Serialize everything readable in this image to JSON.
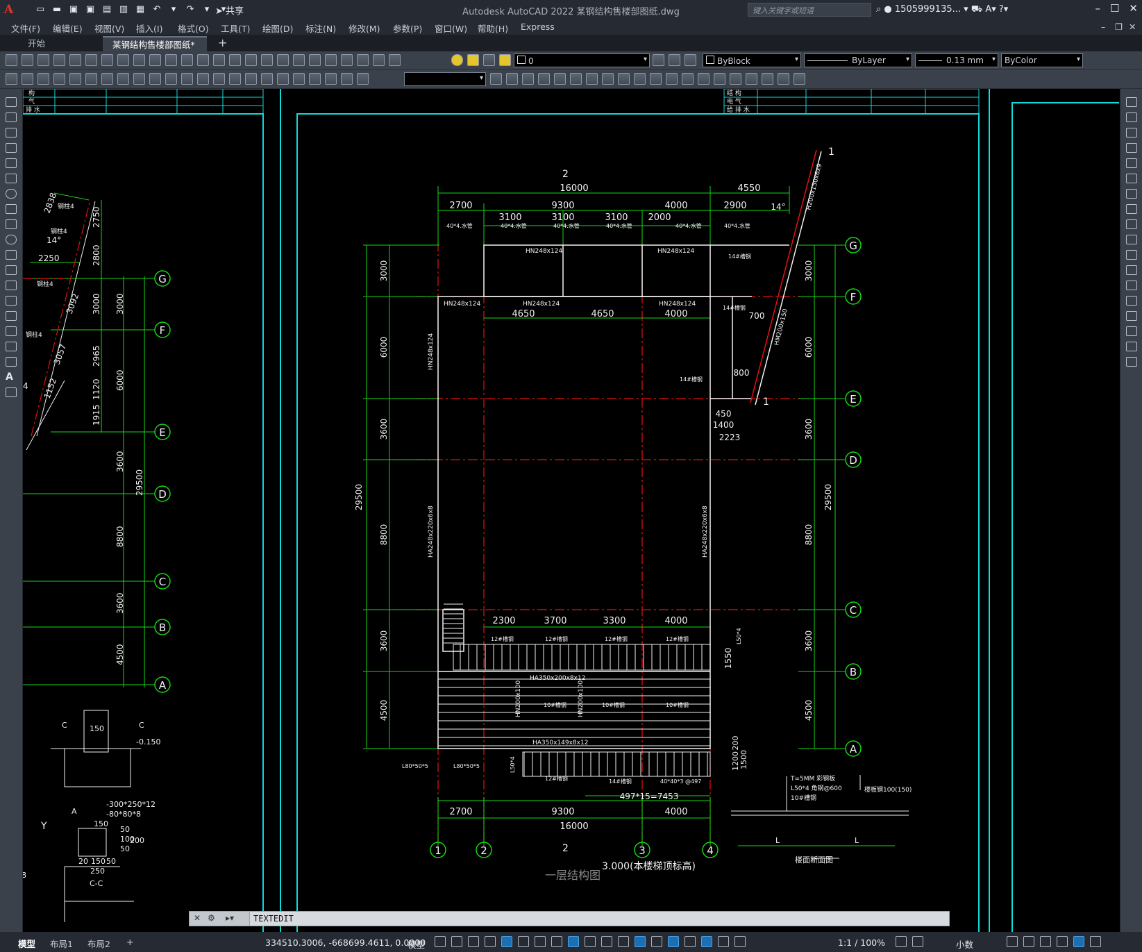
{
  "titlebar": {
    "title": "Autodesk AutoCAD 2022    某钢结构售楼部图纸.dwg",
    "share": "共享",
    "search_placeholder": "键入关键字或短语",
    "user": "1505999135...",
    "logo": "A"
  },
  "menu": [
    "文件(F)",
    "编辑(E)",
    "视图(V)",
    "插入(I)",
    "格式(O)",
    "工具(T)",
    "绘图(D)",
    "标注(N)",
    "修改(M)",
    "参数(P)",
    "窗口(W)",
    "帮助(H)",
    "Express"
  ],
  "tabs": {
    "start": "开始",
    "active": "某钢结构售楼部图纸*",
    "add": "+"
  },
  "toolbar": {
    "layer_value": "0",
    "color_value": "ByBlock",
    "linetype_value": "ByLayer",
    "lineweight_value": "0.13 mm",
    "plotstyle_value": "ByColor"
  },
  "command": {
    "text": "TEXTEDIT"
  },
  "status": {
    "layouts": [
      "模型",
      "布局1",
      "布局2"
    ],
    "coords": "334510.3006, -668699.4611, 0.0000",
    "model": "模型",
    "scale": "1:1 / 100%",
    "units": "小数"
  },
  "drawing": {
    "grid_rows": [
      "G",
      "F",
      "E",
      "D",
      "C",
      "B",
      "A"
    ],
    "grid_cols": [
      "1",
      "2",
      "3",
      "4"
    ],
    "top_dims": [
      "16000",
      "4550",
      "2700",
      "9300",
      "4000",
      "2900",
      "3100",
      "3100",
      "3100",
      "2000",
      "14°"
    ],
    "mid_dims": [
      "4650",
      "4650",
      "4000",
      "700",
      "800",
      "450",
      "1400",
      "2223"
    ],
    "left_vert_dims": [
      "3000",
      "6000",
      "3600",
      "8800",
      "3600",
      "4500",
      "29500"
    ],
    "right_vert_dims": [
      "3000",
      "6000",
      "3600",
      "8800",
      "3600",
      "4500",
      "29500"
    ],
    "stair_dims": [
      "2300",
      "3700",
      "3300",
      "4000",
      "1550"
    ],
    "bottom_dims": [
      "2700",
      "9300",
      "4000",
      "16000",
      "497*15=7453",
      "1200",
      "200",
      "1500"
    ],
    "member_labels": [
      "HN248x124",
      "HN248x124",
      "HN248x124",
      "HN248x124",
      "HN248x124",
      "HN248x124",
      "HA248x220x6x8",
      "HA248x220x6x8",
      "HA350x200x8x12",
      "HA350x149x8x12",
      "HN200x100",
      "HN200x100",
      "H200x150x6x9",
      "HM200x150"
    ],
    "small_labels": [
      "40*4.水管",
      "40*4.水管",
      "40*4.水管",
      "40*4.水管",
      "40*4.水管",
      "40*4.水管",
      "14#槽钢",
      "14#槽钢",
      "14#槽钢",
      "12#槽钢",
      "12#槽钢",
      "12#槽钢",
      "12#槽钢",
      "10#槽钢",
      "10#槽钢",
      "10#槽钢",
      "L80*50*5",
      "L80*50*5",
      "L50*4",
      "L50*4",
      "40*40*3 @497",
      "12#槽钢",
      "14#槽钢"
    ],
    "section_markers": [
      "2",
      "1",
      "1",
      "2"
    ],
    "left_panel": {
      "dims": [
        "2838",
        "2750",
        "2800",
        "3000",
        "3000",
        "2965",
        "6000",
        "1120",
        "1915",
        "3600",
        "29500",
        "8800",
        "3600",
        "4500",
        "2250",
        "3092",
        "3057",
        "1152",
        "14°",
        "4"
      ],
      "labels": [
        "钢柱4",
        "钢柱4",
        "钢柱4",
        "钢柱4"
      ],
      "rows": [
        "G",
        "F",
        "E",
        "D",
        "C",
        "B",
        "A"
      ],
      "detail": [
        "C",
        "C",
        "150",
        "-0.150",
        "-300*250*12",
        "-80*80*8",
        "A",
        "150",
        "50",
        "100",
        "50",
        "200",
        "20",
        "150",
        "50",
        "250",
        "Y",
        "C-C"
      ]
    },
    "title_block_rows": [
      "结  构",
      "电  气",
      "给 排 水"
    ],
    "left_title_rows": [
      "构",
      "气",
      "排 水"
    ],
    "section_detail": [
      "T=5MM 彩钢板",
      "L50*4 角钢@600",
      "10#槽钢",
      "楼板钢100(150)",
      "L",
      "L",
      "楼面断面图"
    ],
    "captions": [
      "一层结构图",
      "3.000(本楼梯顶标高)"
    ],
    "canvas_bottom": "8"
  },
  "colors": {
    "grid_line": "#e81010",
    "dim": "#14d814",
    "frame": "#10dada",
    "white": "#f2f2f2"
  }
}
